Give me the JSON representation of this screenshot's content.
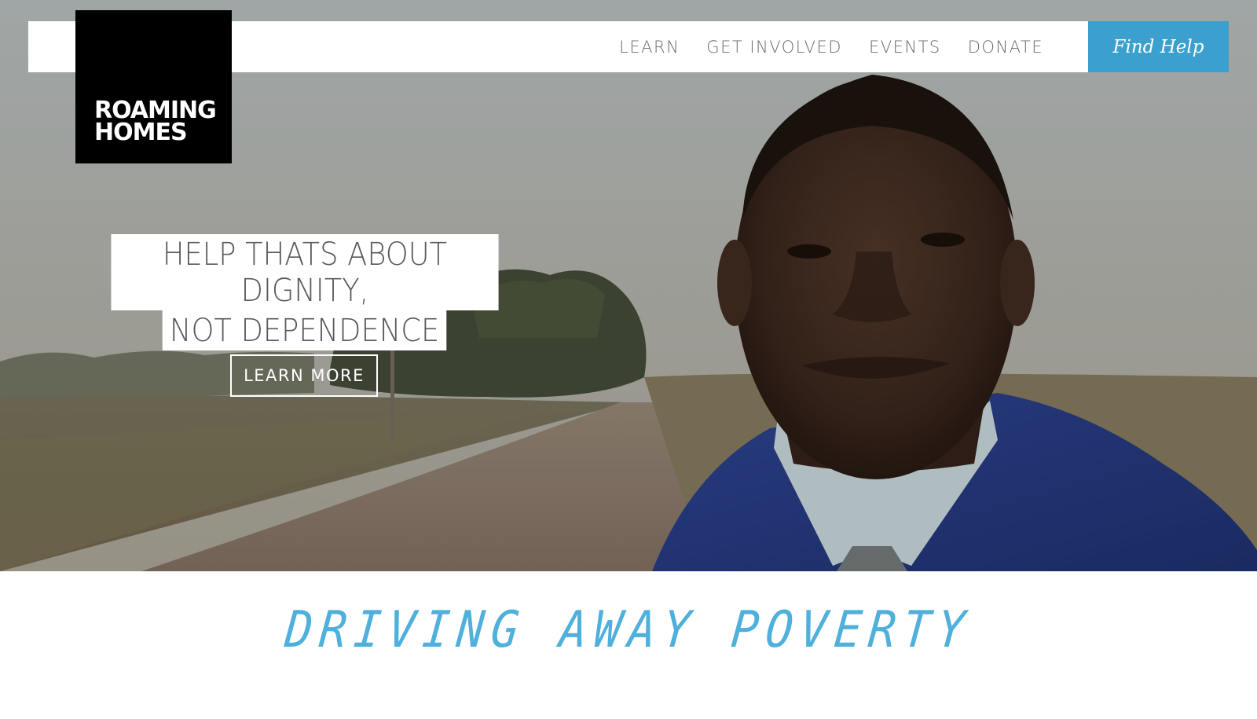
{
  "brand": {
    "logo_line1": "ROAMING",
    "logo_line2": "HOMES"
  },
  "nav": {
    "items": [
      {
        "label": "LEARN"
      },
      {
        "label": "GET INVOLVED"
      },
      {
        "label": "EVENTS"
      },
      {
        "label": "DONATE"
      }
    ],
    "cta_label": "Find Help"
  },
  "hero": {
    "headline_line1": "HELP THATS ABOUT DIGNITY,",
    "headline_line2": "NOT DEPENDENCE",
    "button_label": "LEARN MORE"
  },
  "section": {
    "tagline": "DRIVING AWAY POVERTY"
  },
  "colors": {
    "accent": "#3ba0cd",
    "tagline": "#4fb0dc",
    "logo_bg": "#000000",
    "nav_text": "#6b6b6b"
  }
}
